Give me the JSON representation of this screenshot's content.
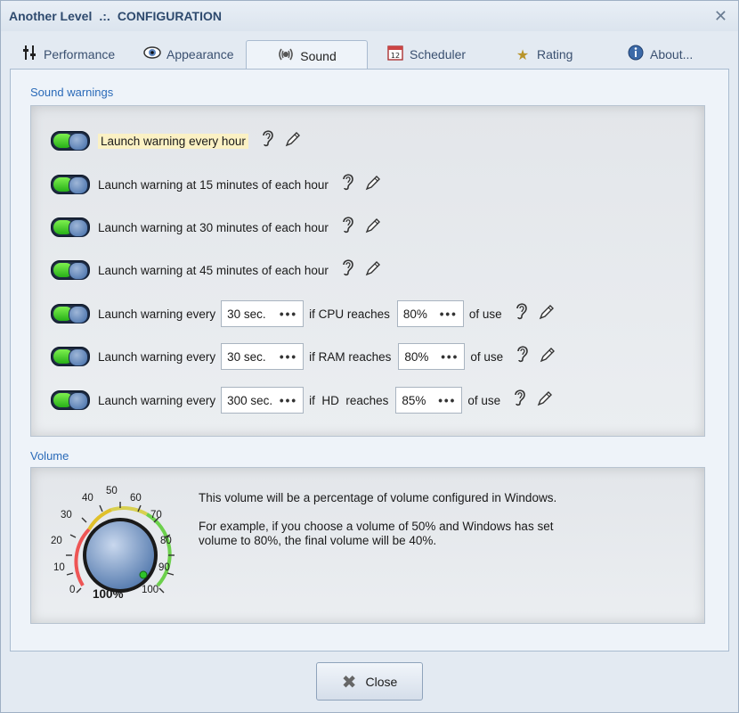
{
  "window": {
    "app_name": "Another Level",
    "separator": ".:.",
    "section": "CONFIGURATION",
    "close_glyph": "✕"
  },
  "tabs": [
    {
      "label": "Performance",
      "icon": "sliders-icon",
      "glyph": "⫯"
    },
    {
      "label": "Appearance",
      "icon": "eye-icon",
      "glyph": "◉"
    },
    {
      "label": "Sound",
      "icon": "speaker-icon",
      "glyph": "◎",
      "active": true
    },
    {
      "label": "Scheduler",
      "icon": "calendar-icon",
      "glyph": "▦"
    },
    {
      "label": "Rating",
      "icon": "star-icon",
      "glyph": "★"
    },
    {
      "label": "About...",
      "icon": "info-icon",
      "glyph": "ℹ"
    }
  ],
  "sound_warnings": {
    "title": "Sound warnings",
    "rows": [
      {
        "label": "Launch warning every hour",
        "enabled": true,
        "highlighted": true
      },
      {
        "label": "Launch warning at 15 minutes of each hour",
        "enabled": true
      },
      {
        "label": "Launch warning at 30 minutes of each hour",
        "enabled": true
      },
      {
        "label": "Launch warning at 45 minutes of each hour",
        "enabled": true
      }
    ],
    "resource_rows": [
      {
        "prefix": "Launch warning every",
        "interval": "30 sec.",
        "mid": "if CPU reaches",
        "threshold": "80%",
        "suffix": "of use",
        "enabled": true
      },
      {
        "prefix": "Launch warning every",
        "interval": "30 sec.",
        "mid": "if RAM reaches",
        "threshold": "80%",
        "suffix": "of use",
        "enabled": true
      },
      {
        "prefix": "Launch warning every",
        "interval": "300 sec.",
        "mid": "if  HD  reaches",
        "threshold": "85%",
        "suffix": "of use",
        "enabled": true
      }
    ],
    "dots": "•••",
    "ear_glyph": "❓",
    "pencil_glyph": "✎"
  },
  "volume": {
    "title": "Volume",
    "value_label": "100%",
    "value": 100,
    "scale_labels": [
      "0",
      "10",
      "20",
      "30",
      "40",
      "50",
      "60",
      "70",
      "80",
      "90",
      "100"
    ],
    "info_line1": "This volume will be a percentage of volume configured in Windows.",
    "info_line2": "For example, if you choose a volume of 50% and Windows has set",
    "info_line3": "volume to 80%, the final volume will be 40%."
  },
  "footer": {
    "close_label": "Close",
    "close_glyph": "✖"
  }
}
